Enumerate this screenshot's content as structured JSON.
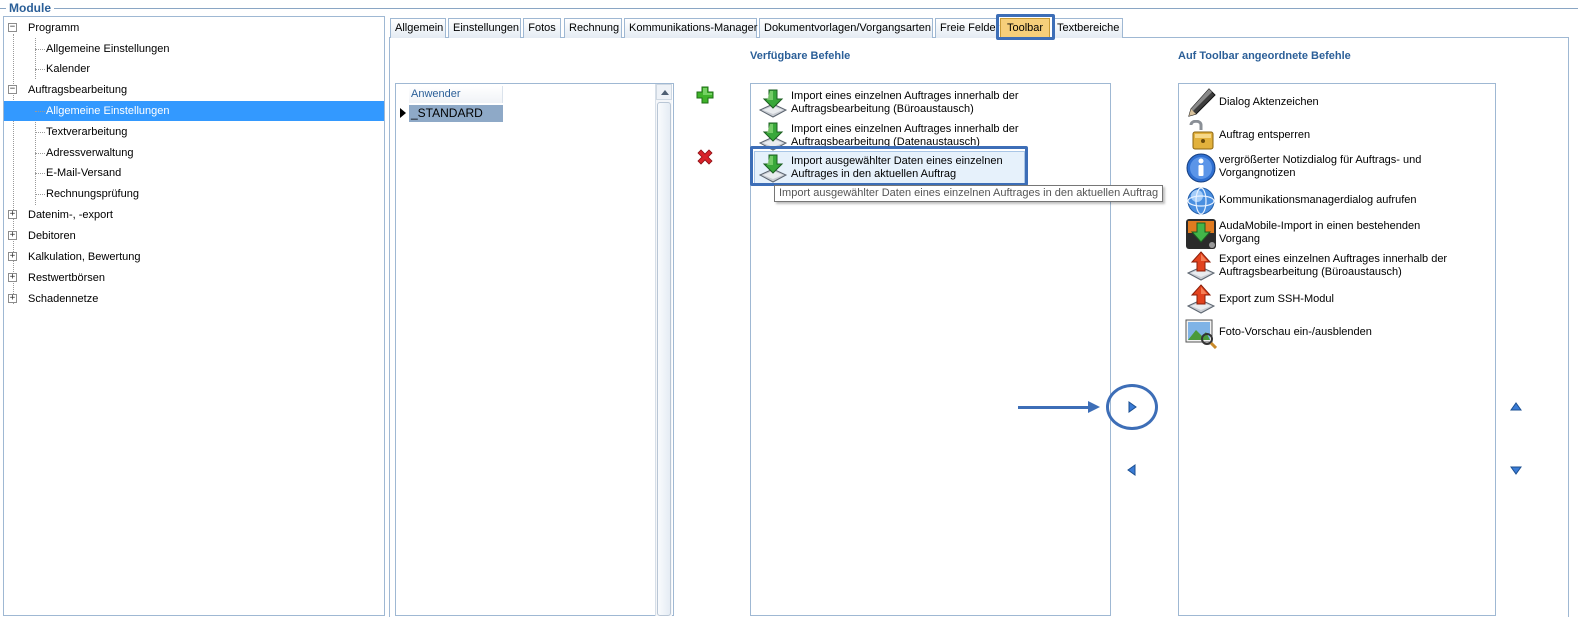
{
  "group": {
    "title": "Module"
  },
  "tree": [
    {
      "label": "Programm",
      "level": 0,
      "toggle": "−"
    },
    {
      "label": "Allgemeine Einstellungen",
      "level": 1
    },
    {
      "label": "Kalender",
      "level": 1
    },
    {
      "label": "Auftragsbearbeitung",
      "level": 0,
      "toggle": "−"
    },
    {
      "label": "Allgemeine Einstellungen",
      "level": 1,
      "selected": true
    },
    {
      "label": "Textverarbeitung",
      "level": 1
    },
    {
      "label": "Adressverwaltung",
      "level": 1
    },
    {
      "label": "E-Mail-Versand",
      "level": 1
    },
    {
      "label": "Rechnungsprüfung",
      "level": 1
    },
    {
      "label": "Datenim-, -export",
      "level": 0,
      "toggle": "+"
    },
    {
      "label": "Debitoren",
      "level": 0,
      "toggle": "+"
    },
    {
      "label": "Kalkulation, Bewertung",
      "level": 0,
      "toggle": "+"
    },
    {
      "label": "Restwertbörsen",
      "level": 0,
      "toggle": "+"
    },
    {
      "label": "Schadennetze",
      "level": 0,
      "toggle": "+"
    }
  ],
  "tabs": [
    {
      "label": "Allgemein"
    },
    {
      "label": "Einstellungen"
    },
    {
      "label": "Fotos"
    },
    {
      "label": "Rechnung"
    },
    {
      "label": "Kommunikations-Manager"
    },
    {
      "label": "Dokumentvorlagen/Vorgangsarten"
    },
    {
      "label": "Freie Felder"
    },
    {
      "label": "Toolbar",
      "active": true
    },
    {
      "label": "Textbereiche"
    }
  ],
  "users": {
    "column_header": "Anwender",
    "rows": [
      "_STANDARD"
    ]
  },
  "available": {
    "heading": "Verfügbare Befehle",
    "items": [
      {
        "line1": "Import eines einzelnen Auftrages innerhalb der",
        "line2": "Auftragsbearbeitung (Büroaustausch)",
        "icon": "import-down-arrow-icon"
      },
      {
        "line1": "Import eines einzelnen Auftrages innerhalb der",
        "line2": "Auftragsbearbeitung (Datenaustausch)",
        "icon": "import-down-arrow-icon"
      },
      {
        "line1": "Import ausgewählter Daten eines einzelnen",
        "line2": "Auftrages in den aktuellen Auftrag",
        "icon": "import-down-arrow-icon"
      }
    ],
    "tooltip": "Import ausgewählter Daten eines einzelnen Auftrages in den aktuellen Auftrag"
  },
  "toolbar": {
    "heading": "Auf Toolbar angeordnete Befehle",
    "items": [
      {
        "line1": "Dialog Aktenzeichen",
        "line2": "",
        "icon": "pen-icon"
      },
      {
        "line1": "Auftrag entsperren",
        "line2": "",
        "icon": "unlock-icon"
      },
      {
        "line1": "vergrößerter Notizdialog für Auftrags- und",
        "line2": "Vorgangnotizen",
        "icon": "info-icon"
      },
      {
        "line1": "Kommunikationsmanagerdialog aufrufen",
        "line2": "",
        "icon": "globe-icon"
      },
      {
        "line1": "AudaMobile-Import in einen bestehenden",
        "line2": "Vorgang",
        "icon": "mobile-import-icon"
      },
      {
        "line1": "Export eines einzelnen Auftrages innerhalb der",
        "line2": "Auftragsbearbeitung (Büroaustausch)",
        "icon": "export-up-arrow-icon"
      },
      {
        "line1": "Export zum SSH-Modul",
        "line2": "",
        "icon": "export-up-arrow-icon"
      },
      {
        "line1": "Foto-Vorschau ein-/ausblenden",
        "line2": "",
        "icon": "photo-preview-icon"
      }
    ]
  },
  "colors": {
    "accent": "#3d6eb7",
    "heading": "#2b5f98",
    "selection": "#3399ff",
    "active_tab": "#f6cf7a"
  }
}
